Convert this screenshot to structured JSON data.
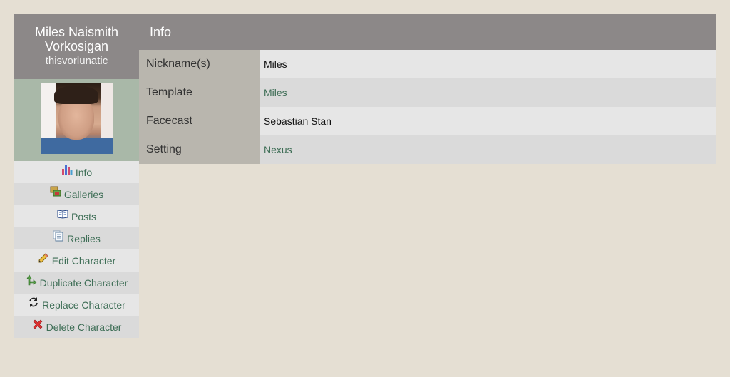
{
  "character": {
    "name": "Miles Naismith Vorkosigan",
    "username": "thisvorlunatic"
  },
  "menu": [
    {
      "label": "Info",
      "icon": "chart-icon"
    },
    {
      "label": "Galleries",
      "icon": "gallery-icon"
    },
    {
      "label": "Posts",
      "icon": "book-icon"
    },
    {
      "label": "Replies",
      "icon": "replies-icon"
    },
    {
      "label": "Edit Character",
      "icon": "pencil-icon"
    },
    {
      "label": "Duplicate Character",
      "icon": "duplicate-arrow-icon"
    },
    {
      "label": "Replace Character",
      "icon": "refresh-icon"
    },
    {
      "label": "Delete Character",
      "icon": "delete-x-icon"
    }
  ],
  "main": {
    "title": "Info",
    "rows": [
      {
        "label": "Nickname(s)",
        "value": "Miles"
      },
      {
        "label": "Template",
        "value": "Miles"
      },
      {
        "label": "Facecast",
        "value": "Sebastian Stan"
      },
      {
        "label": "Setting",
        "value": "Nexus"
      }
    ]
  },
  "colors": {
    "background": "#e5dfd3",
    "header": "#8c8888",
    "link": "#3e6e56",
    "label_bg": "#b9b6ae"
  }
}
